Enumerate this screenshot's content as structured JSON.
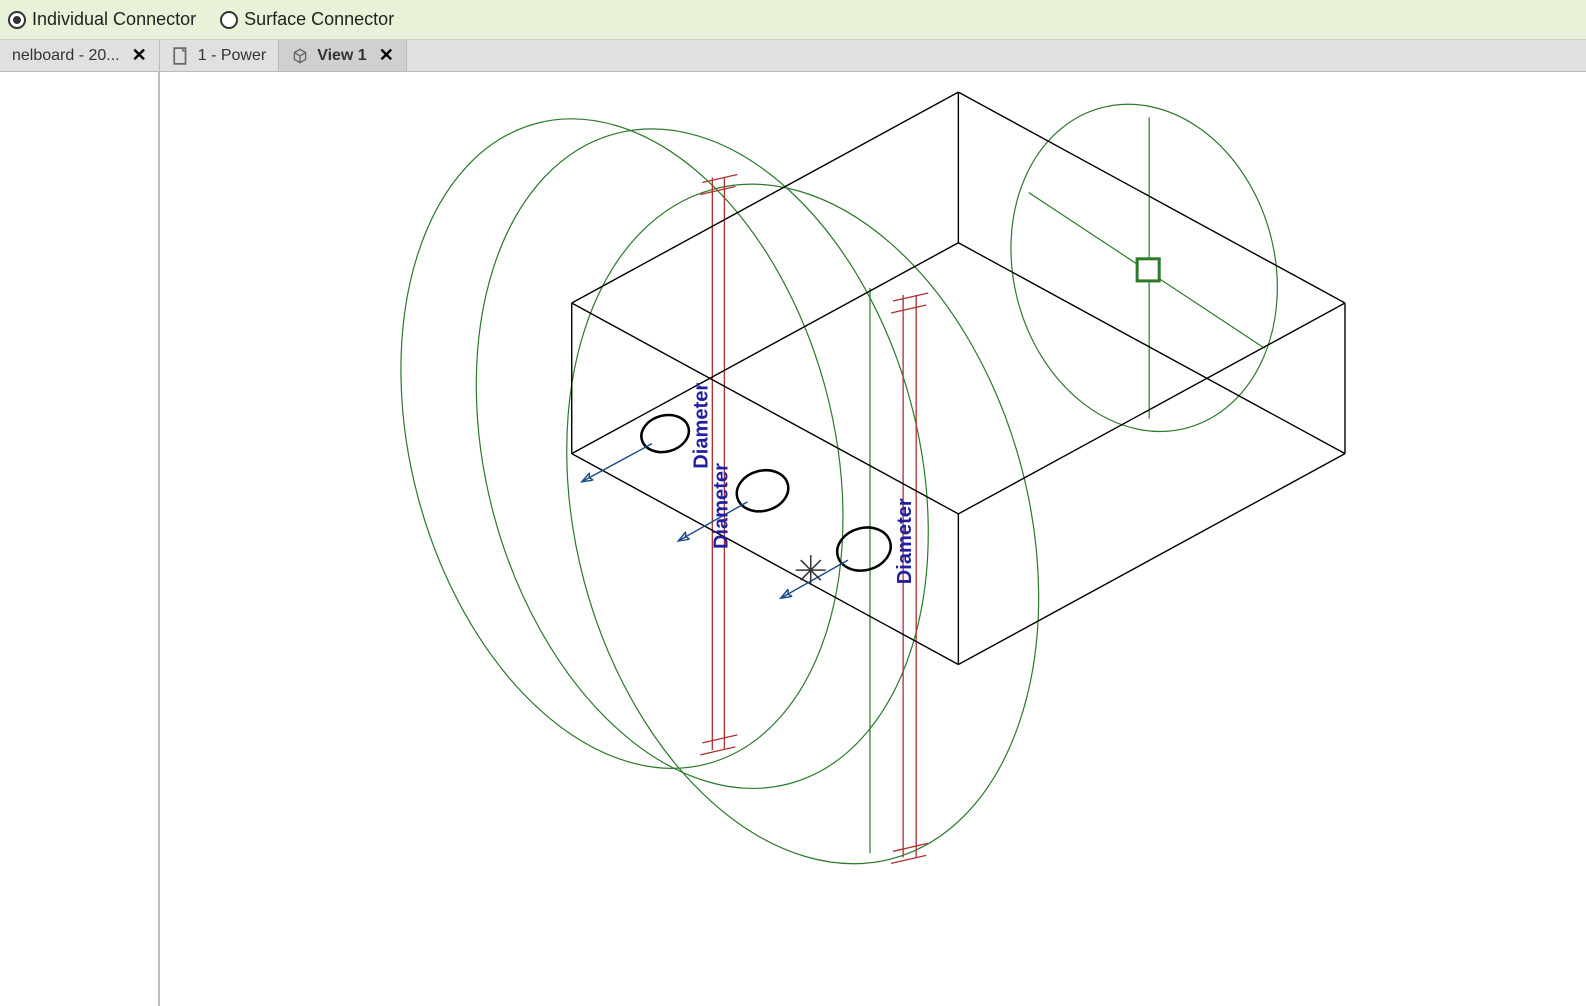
{
  "options": {
    "individual": {
      "label": "Individual Connector",
      "selected": true
    },
    "surface": {
      "label": "Surface Connector",
      "selected": false
    }
  },
  "tabs": [
    {
      "label": "nelboard - 20...",
      "active": false,
      "icon": "sheet"
    },
    {
      "label": "1 - Power",
      "active": false,
      "icon": "sheet"
    },
    {
      "label": "View 1",
      "active": true,
      "icon": "3d"
    }
  ],
  "labels": {
    "diameter1": "Diameter",
    "diameter2": "Diameter",
    "diameter3": "Diameter"
  },
  "colors": {
    "boxStroke": "#000000",
    "greenStroke": "#2a7a2a",
    "redStroke": "#b03030",
    "blueText": "#2020a0",
    "arrowStroke": "#1a4a8a"
  }
}
